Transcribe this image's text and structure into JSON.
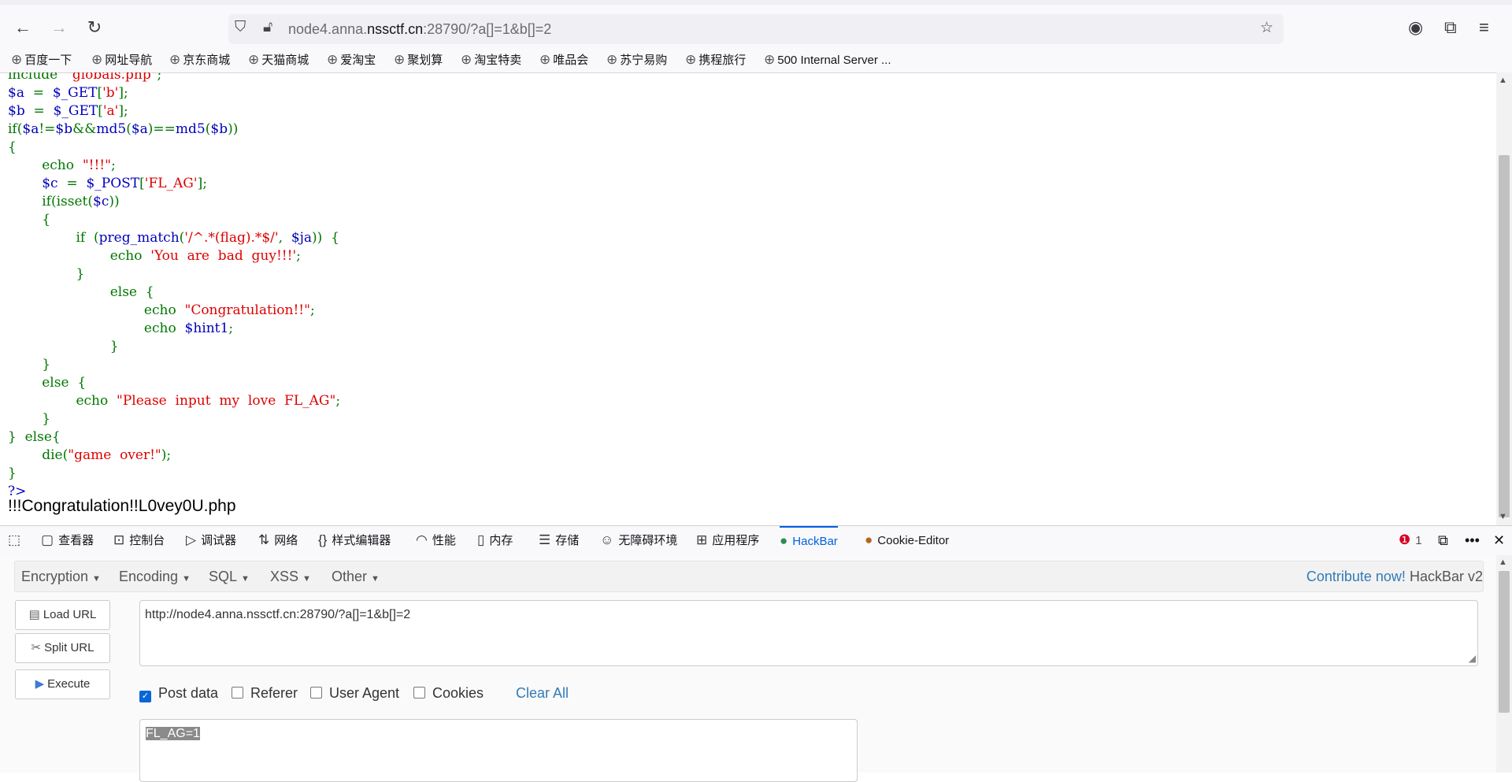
{
  "browser": {
    "url_prefix": "node4.anna.",
    "url_domain": "nssctf.cn",
    "url_suffix": ":28790/?a[]=1&b[]=2",
    "bookmarks": [
      "百度一下",
      "网址导航",
      "京东商城",
      "天猫商城",
      "爱淘宝",
      "聚划算",
      "淘宝特卖",
      "唯品会",
      "苏宁易购",
      "携程旅行",
      "500 Internal Server ..."
    ]
  },
  "page": {
    "output": "!!!Congratulation!!L0vey0U.php"
  },
  "devtools": {
    "tabs": [
      "查看器",
      "控制台",
      "调试器",
      "网络",
      "样式编辑器",
      "性能",
      "内存",
      "存储",
      "无障碍环境",
      "应用程序",
      "HackBar",
      "Cookie-Editor"
    ],
    "error_count": "1"
  },
  "hackbar": {
    "menus": [
      "Encryption",
      "Encoding",
      "SQL",
      "XSS",
      "Other"
    ],
    "contribute": "Contribute now!",
    "version": "HackBar v2",
    "load_url": "Load URL",
    "split_url": "Split URL",
    "execute": "Execute",
    "url_value": "http://node4.anna.nssctf.cn:28790/?a[]=1&b[]=2",
    "options": {
      "post_data": "Post data",
      "referer": "Referer",
      "user_agent": "User Agent",
      "cookies": "Cookies"
    },
    "clear_all": "Clear All",
    "post_value": "FL_AG=1"
  }
}
